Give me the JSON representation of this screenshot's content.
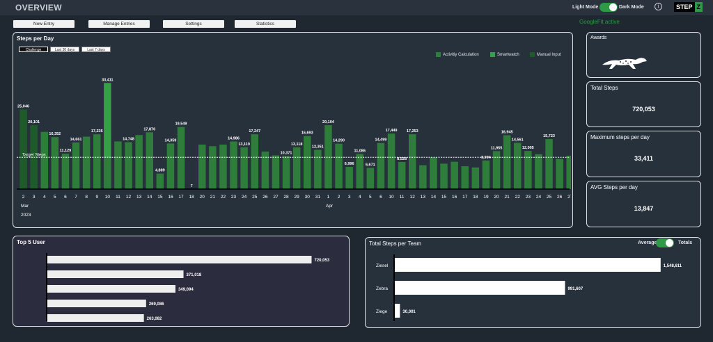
{
  "header": {
    "title": "OVERVIEW",
    "light_mode": "Light Mode",
    "dark_mode": "Dark Mode",
    "info": "i",
    "logo_a": "STEP",
    "logo_b": "Z"
  },
  "nav": [
    "New Entry",
    "Manage Entries",
    "Settings",
    "Statistics"
  ],
  "googlefit_status": "GoogleFit active",
  "steps_panel": {
    "title": "Steps per Day",
    "filters": [
      "Challenge",
      "Last 30 days",
      "Last 7 days"
    ],
    "target_label": "Target Steps"
  },
  "colors": {
    "activity": "#2e7d3a",
    "smartwatch": "#35a045",
    "manual": "#1f5a2a",
    "panel_border": "#dfe3e8"
  },
  "chart_data": [
    {
      "type": "bar",
      "title": "Steps per Day",
      "legend": [
        "Activitiy Calculation",
        "Smartwatch",
        "Manual Input"
      ],
      "legend_position": "top-right",
      "target_label": "Target Steps",
      "target_value": 10000,
      "ylim": [
        0,
        35000
      ],
      "categories": [
        "2",
        "3",
        "4",
        "5",
        "6",
        "7",
        "8",
        "9",
        "10",
        "11",
        "12",
        "13",
        "14",
        "15",
        "16",
        "17",
        "18",
        "20",
        "21",
        "22",
        "23",
        "24",
        "25",
        "26",
        "27",
        "28",
        "29",
        "30",
        "31",
        "1",
        "2",
        "3",
        "4",
        "5",
        "6",
        "10",
        "11",
        "12",
        "13",
        "14",
        "15",
        "16",
        "17",
        "18",
        "19",
        "20",
        "21",
        "22",
        "23",
        "24",
        "25",
        "26",
        "27"
      ],
      "month_labels": [
        {
          "label": "Mar",
          "year": "2023",
          "index": 0
        },
        {
          "label": "Apr",
          "index": 29
        }
      ],
      "values": [
        25046,
        20101,
        18000,
        16352,
        11129,
        14661,
        16500,
        17236,
        33411,
        15000,
        14748,
        17000,
        17870,
        4889,
        14359,
        19549,
        7,
        14000,
        13500,
        14000,
        14986,
        13119,
        17247,
        11800,
        10600,
        10371,
        13118,
        16693,
        12351,
        20104,
        14290,
        6996,
        11086,
        6671,
        14499,
        17449,
        8528,
        17253,
        7500,
        10000,
        8000,
        8600,
        7200,
        6800,
        8994,
        11955,
        16945,
        14561,
        12005,
        11000,
        15723,
        9500,
        10500
      ],
      "data_labels": [
        "25,046",
        "20,101",
        "",
        "16,352",
        "11,129",
        "14,661",
        "",
        "17,236",
        "33,411",
        "",
        "14,748",
        "",
        "17,870",
        "4,889",
        "14,359",
        "19,549",
        "7",
        "",
        "",
        "",
        "14,986",
        "13,119",
        "17,247",
        "",
        "",
        "10,371",
        "13,118",
        "16,693",
        "12,351",
        "20,104",
        "14,290",
        "6,996",
        "11,086",
        "6,671",
        "14,499",
        "17,449",
        "8,528",
        "17,253",
        "",
        "",
        "",
        "",
        "",
        "",
        "8,994",
        "11,955",
        "16,945",
        "14,561",
        "12,005",
        "",
        "15,723",
        "",
        ""
      ],
      "xlabel": "",
      "ylabel": ""
    },
    {
      "type": "bar",
      "orientation": "horizontal",
      "title": "Top 5 User",
      "categories": [
        "",
        "",
        "",
        "",
        ""
      ],
      "values": [
        720053,
        371018,
        349094,
        269086,
        263082
      ],
      "data_labels": [
        "720,053",
        "371,018",
        "349,094",
        "269,086",
        "263,082"
      ],
      "xlim": [
        0,
        740000
      ]
    },
    {
      "type": "bar",
      "orientation": "horizontal",
      "title": "Total Steps per Team",
      "toggle_left": "Average",
      "toggle_right": "Totals",
      "categories": [
        "Ziesel",
        "Zebra",
        "Ziege"
      ],
      "values": [
        1548611,
        991607,
        30001
      ],
      "data_labels": [
        "1,548,611",
        "991,607",
        "30,001"
      ],
      "xlim": [
        0,
        1590000
      ]
    }
  ],
  "kpis": {
    "awards": "Awards",
    "total_label": "Total Steps",
    "total_value": "720,053",
    "max_label": "Maximum steps per day",
    "max_value": "33,411",
    "avg_label": "AVG Steps per day",
    "avg_value": "13,847"
  }
}
